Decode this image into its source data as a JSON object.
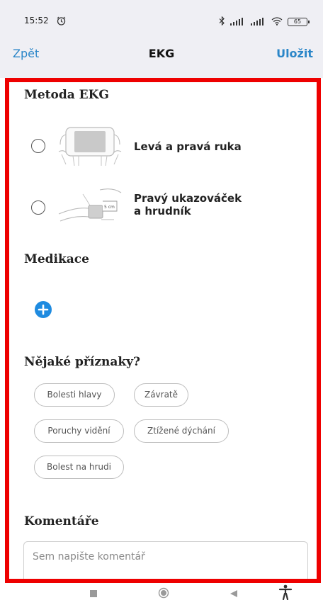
{
  "status_bar": {
    "time": "15:52",
    "battery": "65"
  },
  "nav": {
    "back": "Zpět",
    "title": "EKG",
    "save": "Uložit"
  },
  "method": {
    "heading": "Metoda EKG",
    "options": [
      {
        "label_line1": "Levá a pravá ruka",
        "label_line2": "",
        "image": "hands-on-device-illustration"
      },
      {
        "label_line1": "Pravý ukazováček",
        "label_line2": "a hrudník",
        "image": "finger-on-chest-illustration",
        "image_text": "5 cm"
      }
    ]
  },
  "medication": {
    "heading": "Medikace",
    "add_icon": "plus-circle-icon"
  },
  "symptoms": {
    "heading": "Nějaké příznaky?",
    "chips": [
      "Bolesti hlavy",
      "Závratě",
      "Poruchy vidění",
      "Ztížené dýchání",
      "Bolest na hrudi"
    ]
  },
  "comments": {
    "heading": "Komentáře",
    "placeholder": "Sem napište komentář"
  },
  "system_nav": {
    "icons": [
      "recents-square-icon",
      "home-circle-icon",
      "back-triangle-icon",
      "accessibility-icon"
    ]
  },
  "colors": {
    "accent": "#2b86c8",
    "highlight_border": "#ee0000",
    "add_button": "#1f8be0",
    "bar_background": "#efeff4"
  }
}
